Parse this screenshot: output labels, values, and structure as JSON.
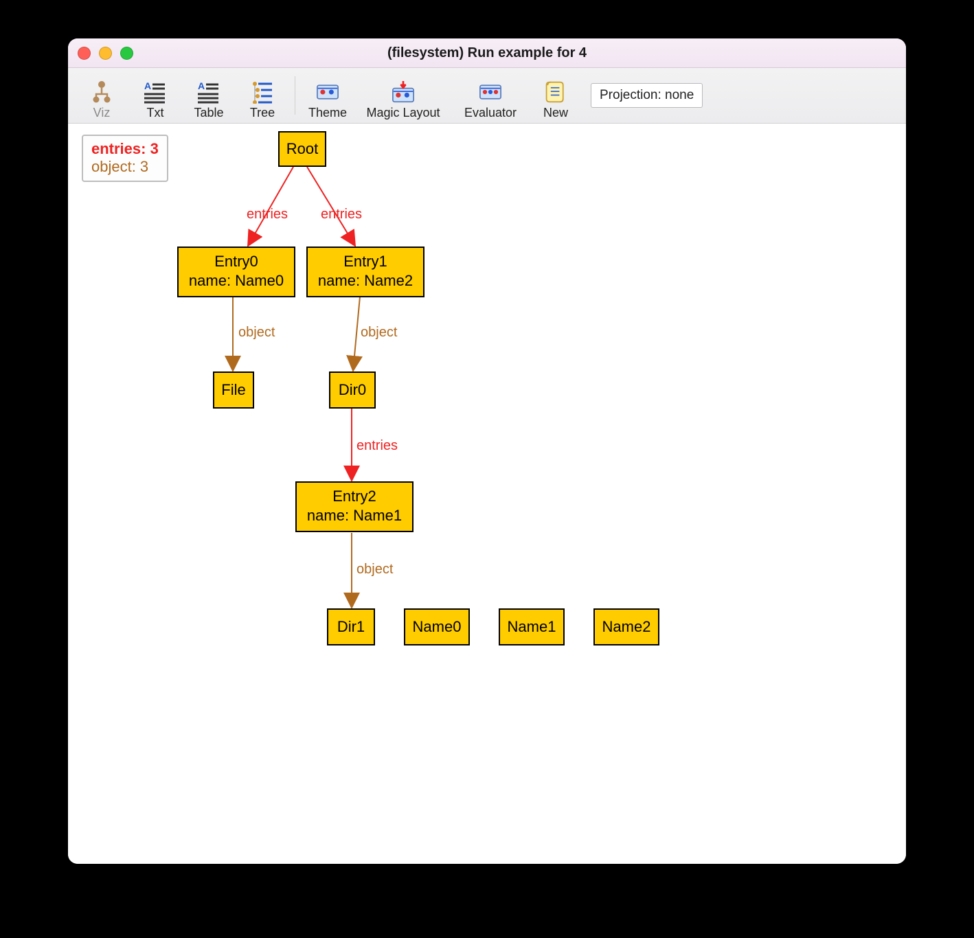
{
  "window": {
    "title": "(filesystem) Run example for 4"
  },
  "toolbar": {
    "viz": "Viz",
    "txt": "Txt",
    "table": "Table",
    "tree": "Tree",
    "theme": "Theme",
    "magic_layout": "Magic Layout",
    "evaluator": "Evaluator",
    "new": "New",
    "projection": "Projection: none"
  },
  "legend": {
    "line1": "entries: 3",
    "line2": "object: 3"
  },
  "relation_labels": {
    "entries": "entries",
    "object": "object"
  },
  "nodes": {
    "root": "Root",
    "entry0_title": "Entry0",
    "entry0_sub": "name: Name0",
    "entry1_title": "Entry1",
    "entry1_sub": "name: Name2",
    "file": "File",
    "dir0": "Dir0",
    "entry2_title": "Entry2",
    "entry2_sub": "name: Name1",
    "dir1": "Dir1",
    "name0": "Name0",
    "name1": "Name1",
    "name2": "Name2"
  }
}
